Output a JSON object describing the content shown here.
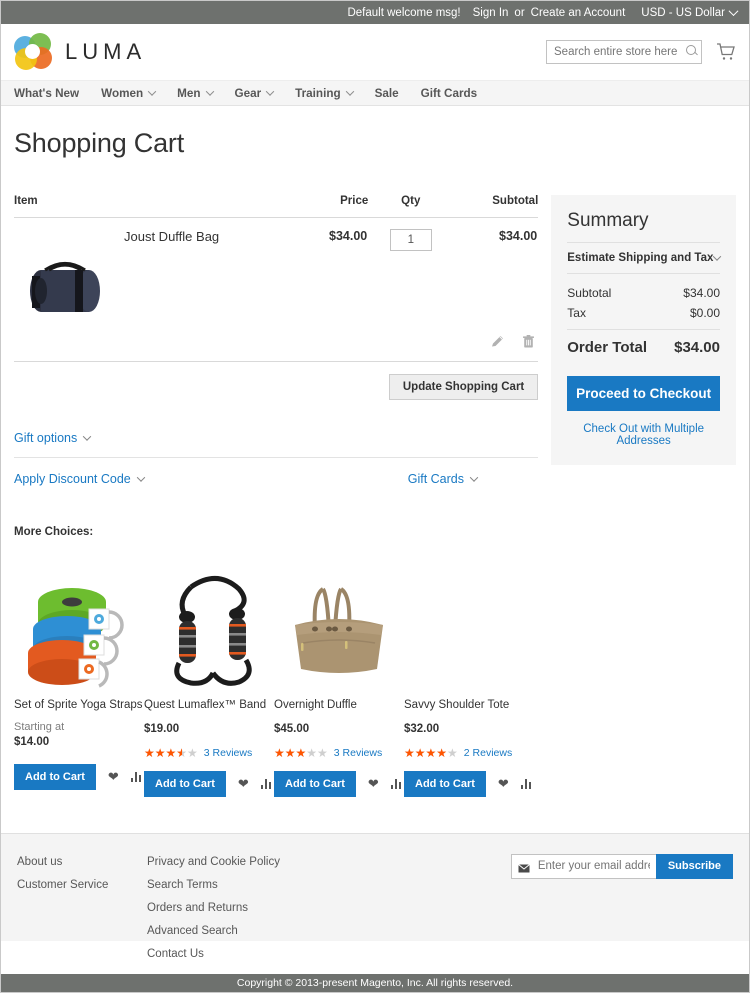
{
  "top_panel": {
    "welcome": "Default welcome msg!",
    "sign_in": "Sign In",
    "or": "or",
    "create_account": "Create an Account",
    "currency": "USD - US Dollar"
  },
  "header": {
    "logo_text": "LUMA",
    "search_placeholder": "Search entire store here...",
    "cart_icon": "shopping-cart-icon"
  },
  "nav": {
    "items": [
      {
        "label": "What's New",
        "has_chevron": false
      },
      {
        "label": "Women",
        "has_chevron": true
      },
      {
        "label": "Men",
        "has_chevron": true
      },
      {
        "label": "Gear",
        "has_chevron": true
      },
      {
        "label": "Training",
        "has_chevron": true
      },
      {
        "label": "Sale",
        "has_chevron": false
      },
      {
        "label": "Gift Cards",
        "has_chevron": false
      }
    ]
  },
  "page": {
    "title": "Shopping Cart"
  },
  "cart": {
    "headers": {
      "item": "Item",
      "price": "Price",
      "qty": "Qty",
      "subtotal": "Subtotal"
    },
    "rows": [
      {
        "name": "Joust Duffle Bag",
        "price": "$34.00",
        "qty": "1",
        "subtotal": "$34.00",
        "image": "joust-duffle-bag-navy"
      }
    ],
    "update_button": "Update Shopping Cart",
    "edit_icon": "pencil-edit-icon",
    "delete_icon": "trash-delete-icon"
  },
  "disclosures": {
    "gift_options": "Gift options",
    "apply_discount": "Apply Discount Code",
    "gift_cards": "Gift Cards"
  },
  "summary": {
    "title": "Summary",
    "estimate": "Estimate Shipping and Tax",
    "subtotal_label": "Subtotal",
    "subtotal_value": "$34.00",
    "tax_label": "Tax",
    "tax_value": "$0.00",
    "order_total_label": "Order Total",
    "order_total_value": "$34.00",
    "checkout_button": "Proceed to Checkout",
    "multiple_addresses": "Check Out with Multiple Addresses",
    "accent_color": "#1979c3"
  },
  "more_choices": {
    "title": "More Choices:",
    "add_to_cart": "Add to Cart",
    "wishlist_icon": "heart-wishlist-icon",
    "compare_icon": "bar-compare-icon",
    "products": [
      {
        "name": "Set of Sprite Yoga Straps",
        "starting_at": "Starting at",
        "price": "$14.00",
        "rating_percent": 0,
        "reviews": "",
        "image": "sprite-yoga-straps",
        "has_rating": false
      },
      {
        "name": "Quest Lumaflex™ Band",
        "starting_at": "",
        "price": "$19.00",
        "rating_percent": 70,
        "reviews": "3 Reviews",
        "image": "quest-lumaflex-band",
        "has_rating": true
      },
      {
        "name": "Overnight Duffle",
        "starting_at": "",
        "price": "$45.00",
        "rating_percent": 60,
        "reviews": "3 Reviews",
        "image": "overnight-duffle-tan",
        "has_rating": true
      },
      {
        "name": "Savvy Shoulder Tote",
        "starting_at": "",
        "price": "$32.00",
        "rating_percent": 80,
        "reviews": "2 Reviews",
        "image": "",
        "has_rating": true
      }
    ]
  },
  "footer": {
    "col1": [
      "About us",
      "Customer Service"
    ],
    "col2": [
      "Privacy and Cookie Policy",
      "Search Terms",
      "Orders and Returns",
      "Advanced Search",
      "Contact Us"
    ],
    "newsletter_placeholder": "Enter your email address",
    "subscribe_button": "Subscribe",
    "envelope_icon": "envelope-icon"
  },
  "copyright": "Copyright © 2013-present Magento, Inc. All rights reserved."
}
